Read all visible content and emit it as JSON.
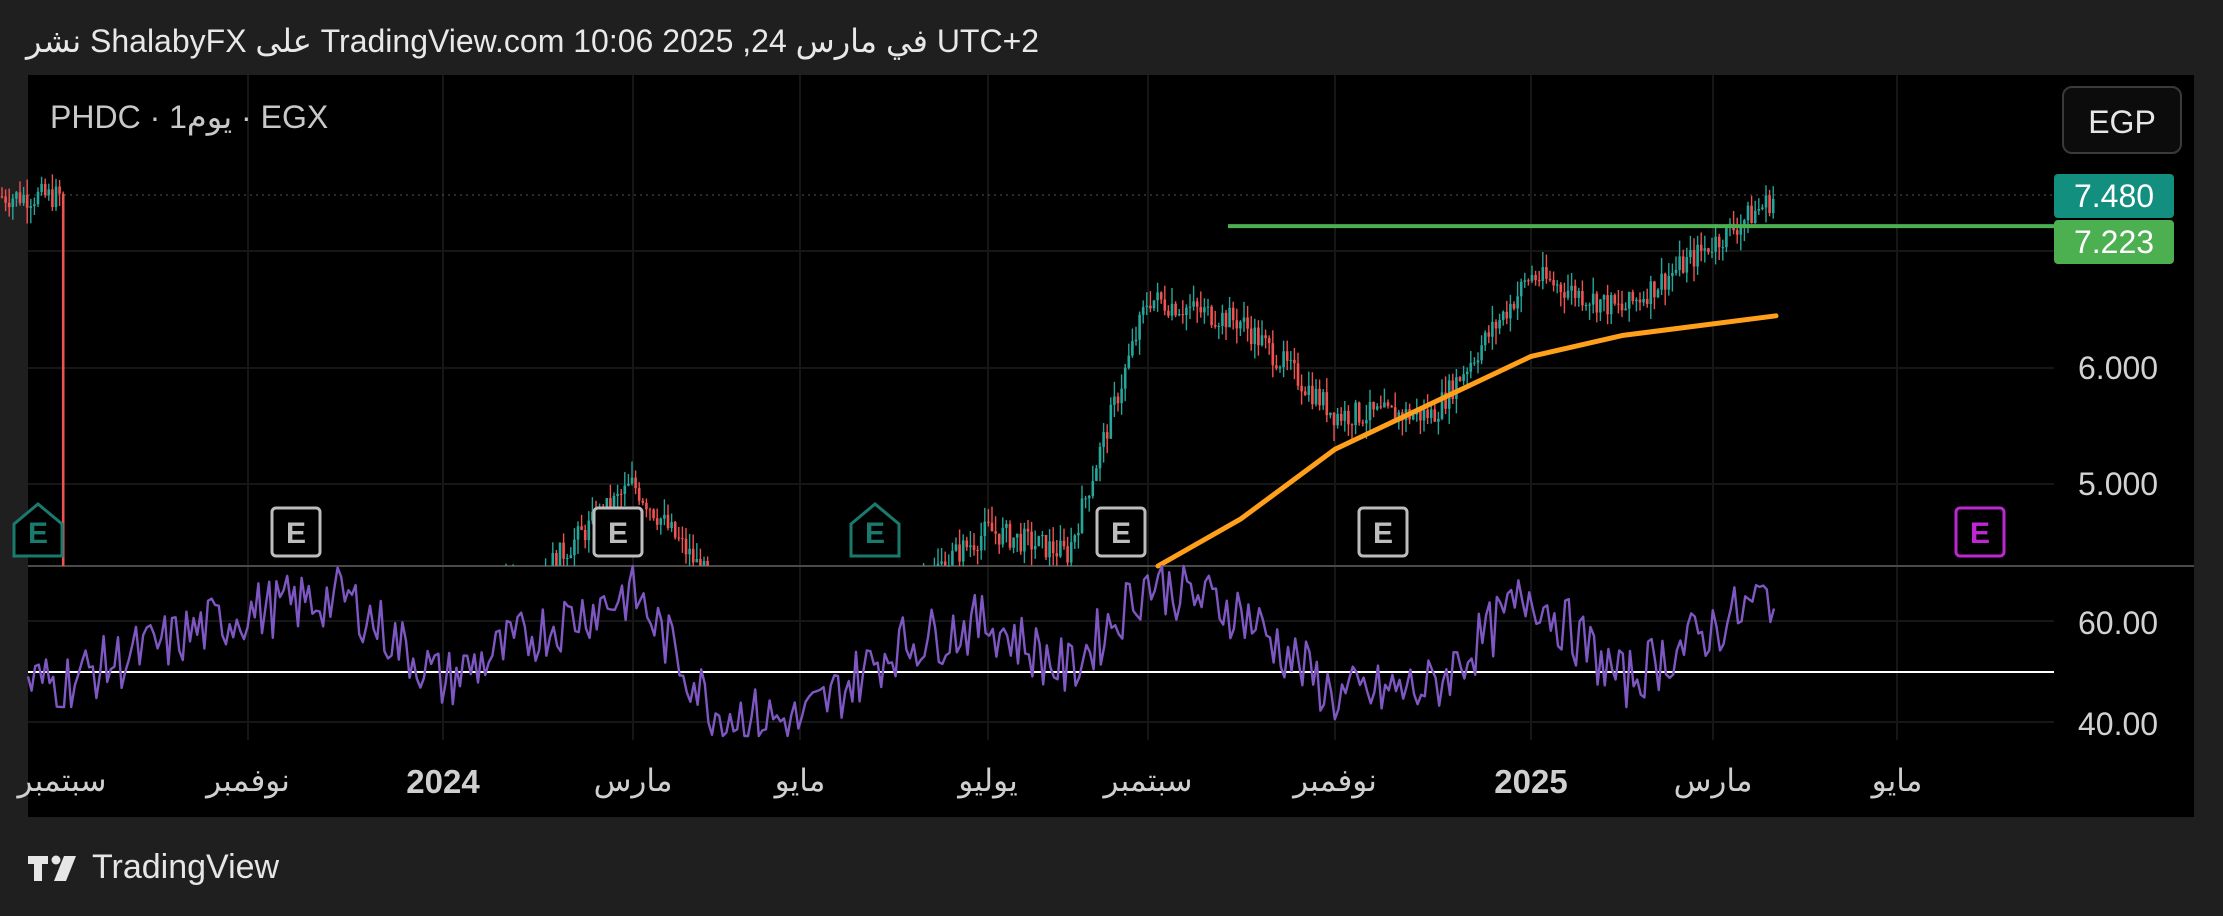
{
  "header": {
    "publish_text": "نشر ShalabyFX على TradingView.com 10:06 2025 ,24 في مارس UTC+2"
  },
  "symbol": {
    "text": "PHDC · 1يوم · EGX"
  },
  "currency_button": {
    "label": "EGP"
  },
  "price_badges": {
    "last": "7.480",
    "line": "7.223"
  },
  "footer": {
    "brand": "TradingView"
  },
  "colors": {
    "up": "#26a69a",
    "down": "#ef5350",
    "ma": "#ff9f1a",
    "resistance": "#4caf50",
    "rsi": "#7e57c2",
    "earnings_future": "#c026d3"
  },
  "chart_data": [
    {
      "type": "line",
      "title": "",
      "description_none": "",
      "y_axis_ticks": [
        "6.000",
        "5.000"
      ],
      "ylim": [
        4.3,
        7.7
      ],
      "current_price": 7.48,
      "resistance_level": 7.223,
      "earnings_markers": [
        "E",
        "E",
        "E",
        "E",
        "E",
        "E",
        "E"
      ],
      "series": [
        {
          "x": [
            "2023-09",
            "2023-10",
            "2023-11",
            "2023-12",
            "2024-01",
            "2024-02",
            "2024-03",
            "2024-04",
            "2024-05",
            "2024-06",
            "2024-07",
            "2024-08",
            "2024-09",
            "2024-10",
            "2024-11",
            "2024-12",
            "2025-01",
            "2025-02",
            "2025-03"
          ],
          "values": [
            3.8,
            3.7,
            3.9,
            3.8,
            3.9,
            4.2,
            5.0,
            4.1,
            3.9,
            4.0,
            4.6,
            4.4,
            6.6,
            6.4,
            5.6,
            5.6,
            6.8,
            6.5,
            7.48
          ]
        },
        {
          "x": [
            "2024-09",
            "2024-10",
            "2024-11",
            "2024-12",
            "2025-01",
            "2025-02",
            "2025-03"
          ],
          "values": [
            4.3,
            4.7,
            5.3,
            5.7,
            6.1,
            6.28,
            6.45
          ]
        }
      ]
    },
    {
      "type": "line",
      "y_axis_ticks": [
        "60.00",
        "40.00"
      ],
      "ylim": [
        36,
        70
      ],
      "reference_line": 50,
      "series": [
        {
          "x": [
            "2023-09",
            "2023-10",
            "2023-11",
            "2023-12",
            "2024-01",
            "2024-02",
            "2024-03",
            "2024-04",
            "2024-05",
            "2024-06",
            "2024-07",
            "2024-08",
            "2024-09",
            "2024-10",
            "2024-11",
            "2024-12",
            "2025-01",
            "2025-02",
            "2025-03"
          ],
          "values": [
            48,
            55,
            62,
            65,
            48,
            58,
            66,
            42,
            40,
            55,
            60,
            50,
            68,
            62,
            45,
            47,
            66,
            48,
            66
          ]
        }
      ]
    }
  ],
  "x_axis_labels": [
    "سبتمبر",
    "نوفمبر",
    "2024",
    "مارس",
    "مايو",
    "يوليو",
    "سبتمبر",
    "نوفمبر",
    "2025",
    "مارس",
    "مايو"
  ]
}
